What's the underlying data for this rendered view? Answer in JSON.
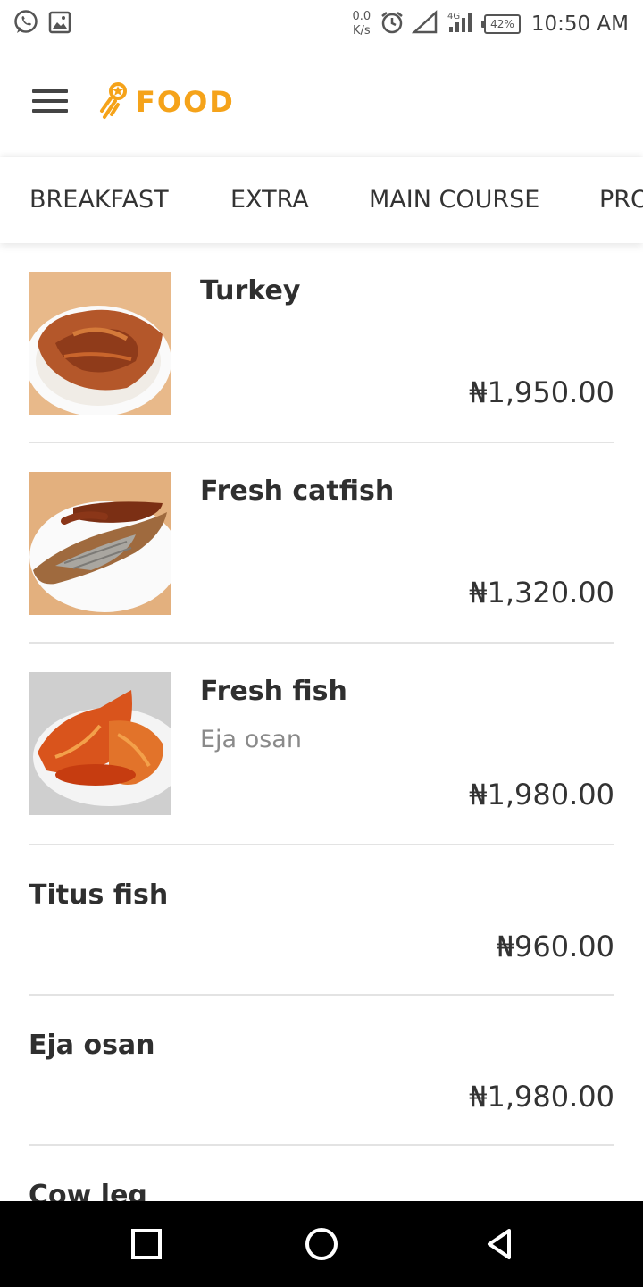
{
  "status_bar": {
    "net_speed_value": "0.0",
    "net_speed_unit": "K/s",
    "network_type": "4G",
    "battery": "42%",
    "time": "10:50 AM",
    "icons": [
      "whatsapp-icon",
      "image-icon",
      "alarm-icon",
      "signal-icon"
    ]
  },
  "app_bar": {
    "brand": "FOOD",
    "brand_color": "#f5a31a",
    "menu_icon": "hamburger-icon"
  },
  "tabs": [
    {
      "label": "BREAKFAST"
    },
    {
      "label": "EXTRA"
    },
    {
      "label": "MAIN COURSE"
    },
    {
      "label": "PRO"
    }
  ],
  "menu": {
    "items": [
      {
        "name": "Turkey",
        "subtitle": "",
        "price": "₦1,950.00",
        "has_image": true
      },
      {
        "name": "Fresh catfish",
        "subtitle": "",
        "price": "₦1,320.00",
        "has_image": true
      },
      {
        "name": "Fresh fish",
        "subtitle": "Eja osan",
        "price": "₦1,980.00",
        "has_image": true
      },
      {
        "name": "Titus fish",
        "subtitle": "",
        "price": "₦960.00",
        "has_image": false
      },
      {
        "name": "Eja osan",
        "subtitle": "",
        "price": "₦1,980.00",
        "has_image": false
      },
      {
        "name": "Cow leg",
        "subtitle": "",
        "price": "",
        "has_image": false
      }
    ]
  },
  "nav_bar": {
    "icons": [
      "recents-icon",
      "home-icon",
      "back-icon"
    ]
  }
}
